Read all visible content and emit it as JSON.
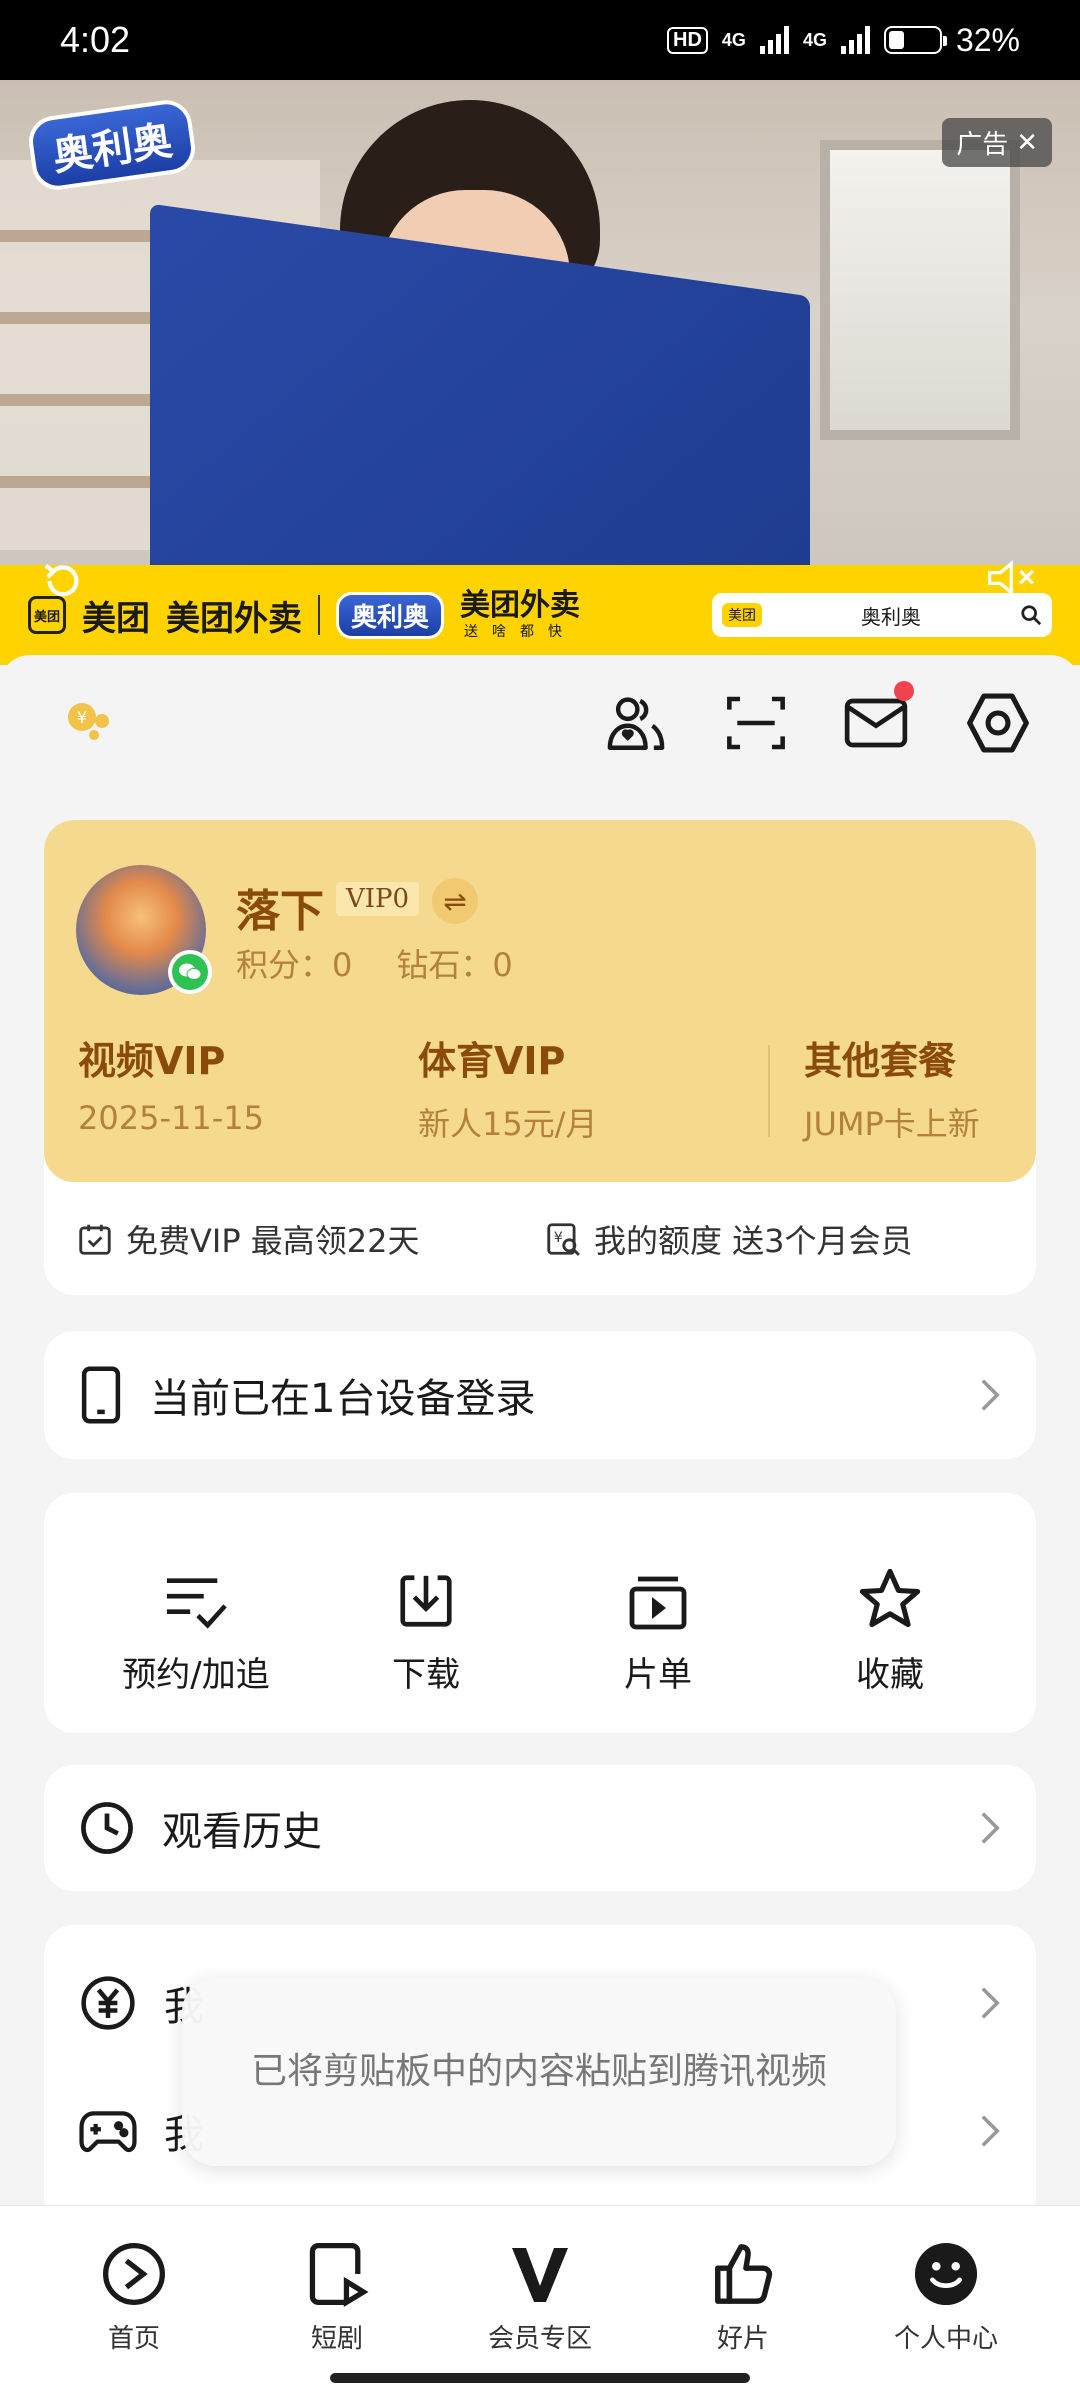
{
  "status_bar": {
    "time": "4:02",
    "hd": "HD",
    "network_1": "4G",
    "network_2": "4G",
    "battery_level": 0.32,
    "battery": "32%"
  },
  "ad": {
    "brand": "奥利奥",
    "tag": "广告",
    "strip": {
      "meituan": "美团",
      "mini_label": "美团",
      "waimai": "美团外卖",
      "oreo": "奥利奥",
      "waimai_2": "美团外卖",
      "slogan": "送啥都快",
      "search_mini": "美团",
      "search_keyword": "奥利奥"
    }
  },
  "profile": {
    "username": "落下",
    "vip_level": "VIP0",
    "points": "积分：0",
    "diamonds": "钻石：0"
  },
  "vip_plans": [
    {
      "title": "视频VIP",
      "sub": "2025-11-15"
    },
    {
      "title": "体育VIP",
      "sub": "新人15元/月"
    },
    {
      "title": "其他套餐",
      "sub": "JUMP卡上新"
    }
  ],
  "vip_links": {
    "free_vip": "免费VIP 最高领22天",
    "quota": "我的额度 送3个月会员"
  },
  "device_row": {
    "label": "当前已在1台设备登录"
  },
  "quick_actions": [
    {
      "label": "预约/加追",
      "icon": "list-check-icon"
    },
    {
      "label": "下载",
      "icon": "download-icon"
    },
    {
      "label": "片单",
      "icon": "playlist-icon"
    },
    {
      "label": "收藏",
      "icon": "star-icon"
    }
  ],
  "history_row": {
    "label": "观看历史"
  },
  "partial_rows": [
    {
      "label": "我",
      "icon": "yuan-icon"
    },
    {
      "label": "我",
      "icon": "gamepad-icon"
    }
  ],
  "toast": "已将剪贴板中的内容粘贴到腾讯视频",
  "tabs": [
    {
      "label": "首页",
      "icon": "play-icon"
    },
    {
      "label": "短剧",
      "icon": "short-drama-icon"
    },
    {
      "label": "会员专区",
      "icon": "v-icon"
    },
    {
      "label": "好片",
      "icon": "thumbs-up-icon"
    },
    {
      "label": "个人中心",
      "icon": "face-icon"
    }
  ],
  "colors": {
    "vip_card": "#f5d98f",
    "vip_text": "#8a4b0a",
    "ad_strip": "#ffd300",
    "badge_red": "#f0434f",
    "wechat_green": "#2dc252"
  }
}
